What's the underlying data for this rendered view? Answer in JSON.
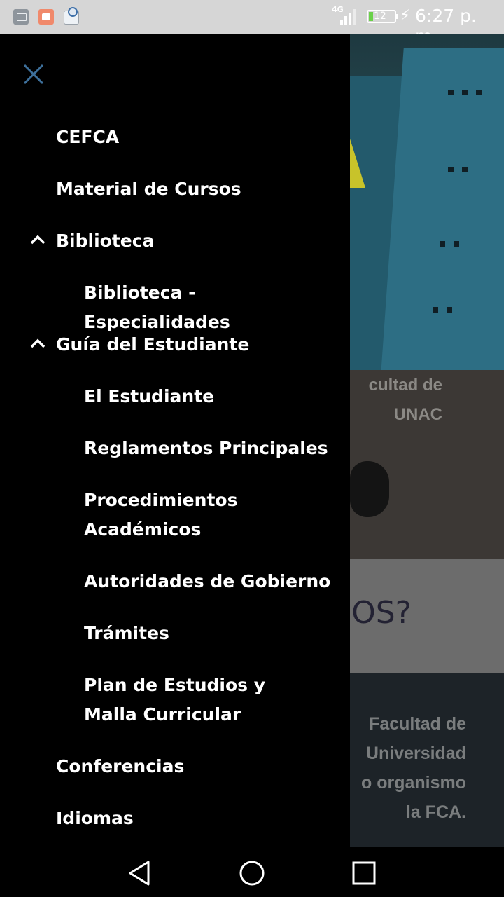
{
  "status_bar": {
    "network": "4G",
    "battery": "12",
    "time": "6:27 p. m."
  },
  "background": {
    "hero_line1": "cultad de",
    "hero_line2": "UNAC",
    "band_heading": "OS?",
    "paragraph": [
      "Facultad de",
      "Universidad",
      "o organismo",
      "la FCA."
    ]
  },
  "drawer": {
    "items": [
      {
        "label": "CEFCA"
      },
      {
        "label": "Material de Cursos"
      },
      {
        "label": "Biblioteca"
      },
      {
        "label": "Biblioteca - Especialidades"
      },
      {
        "label": "Guía del Estudiante"
      },
      {
        "label": "El Estudiante"
      },
      {
        "label": "Reglamentos Principales"
      },
      {
        "label": "Procedimientos Académicos"
      },
      {
        "label": "Autoridades de Gobierno"
      },
      {
        "label": "Trámites"
      },
      {
        "label": "Plan de Estudios y Malla Curricular"
      },
      {
        "label": "Conferencias"
      },
      {
        "label": "Idiomas"
      }
    ]
  },
  "colors": {
    "close_icon": "#3d6f9a",
    "drawer_bg": "#000000",
    "text": "#ffffff"
  }
}
